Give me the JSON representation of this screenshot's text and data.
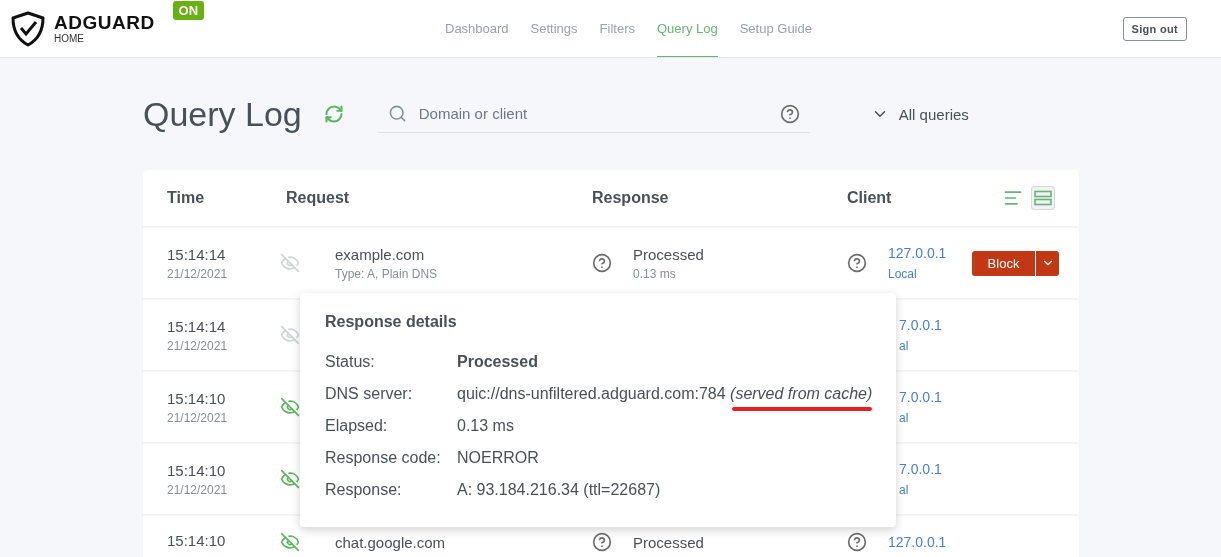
{
  "header": {
    "logo": {
      "title": "ADGUARD",
      "subtitle": "HOME"
    },
    "status_badge": "ON",
    "nav": [
      {
        "label": "Dashboard",
        "selected": false
      },
      {
        "label": "Settings",
        "selected": false
      },
      {
        "label": "Filters",
        "selected": false
      },
      {
        "label": "Query Log",
        "selected": true
      },
      {
        "label": "Setup Guide",
        "selected": false
      }
    ],
    "sign_out": "Sign out"
  },
  "page": {
    "title": "Query Log",
    "search": {
      "placeholder": "Domain or client"
    },
    "filter": "All queries"
  },
  "table": {
    "columns": [
      "Time",
      "Request",
      "Response",
      "Client"
    ],
    "view_modes": [
      {
        "kind": "compact",
        "selected": false
      },
      {
        "kind": "default",
        "selected": true
      }
    ],
    "rows": [
      {
        "kind": "full",
        "time": "15:14:14",
        "date": "21/12/2021",
        "highlighted": false,
        "domain": "example.com",
        "type": "Type: A, Plain DNS",
        "status": "Processed",
        "elapsed": "0.13 ms",
        "client_ip": "127.0.0.1",
        "client_name": "Local",
        "block": "Block"
      },
      {
        "kind": "covered",
        "time": "15:14:14",
        "date": "21/12/2021",
        "highlighted": false,
        "client_ip": "7.0.0.1",
        "client_name": "al"
      },
      {
        "kind": "covered",
        "time": "15:14:10",
        "date": "21/12/2021",
        "highlighted": true,
        "client_ip": "7.0.0.1",
        "client_name": "al"
      },
      {
        "kind": "covered",
        "time": "15:14:10",
        "date": "21/12/2021",
        "highlighted": true,
        "client_ip": "7.0.0.1",
        "client_name": "al"
      },
      {
        "kind": "full",
        "time": "15:14:10",
        "highlighted": true,
        "domain": "chat.google.com",
        "status": "Processed",
        "client_ip": "127.0.0.1"
      }
    ]
  },
  "popup": {
    "title": "Response details",
    "rows": [
      {
        "label": "Status:",
        "value": "Processed",
        "kind": "bold"
      },
      {
        "label": "DNS server:",
        "value": "quic://dns-unfiltered.adguard.com:784",
        "note": "(served from cache)",
        "kind": "plain"
      },
      {
        "label": "Elapsed:",
        "value": "0.13 ms",
        "kind": "plain"
      },
      {
        "label": "Response code:",
        "value": "NOERROR",
        "kind": "plain"
      },
      {
        "label": "Response:",
        "value": "A: 93.184.216.34 (ttl=22687)",
        "kind": "plain"
      }
    ]
  }
}
